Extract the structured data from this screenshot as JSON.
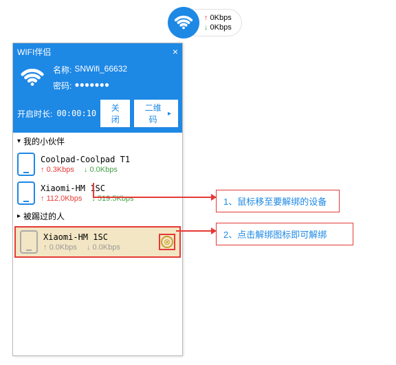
{
  "top_badge": {
    "up": "0Kbps",
    "down": "0Kbps"
  },
  "panel": {
    "title": "WIFI伴侣",
    "close": "×",
    "name_label": "名称:",
    "name_value": "SNWifi_66632",
    "pass_label": "密码:",
    "pass_value": "●●●●●●●",
    "duration_label": "开启时长:",
    "duration_value": "00:00:10",
    "btn_close": "关闭",
    "btn_qr": "二维码",
    "chev": "▸"
  },
  "sections": {
    "partners": "我的小伙伴",
    "kicked": "被踢过的人",
    "tri_down": "▾",
    "tri_right": "▸"
  },
  "devices": {
    "partners": [
      {
        "name": "Coolpad-Coolpad T1",
        "up": "0.3Kbps",
        "down": "0.0Kbps"
      },
      {
        "name": "Xiaomi-HM 1SC",
        "up": "112.0Kbps",
        "down": "519.5Kbps"
      }
    ],
    "kicked": [
      {
        "name": "Xiaomi-HM 1SC",
        "up": "0.0Kbps",
        "down": "0.0Kbps",
        "unbind_glyph": "⊗"
      }
    ]
  },
  "callouts": {
    "c1": "1、鼠标移至要解绑的设备",
    "c2": "2、点击解绑图标即可解绑"
  },
  "arrows": {
    "up": "↑",
    "down": "↓"
  }
}
